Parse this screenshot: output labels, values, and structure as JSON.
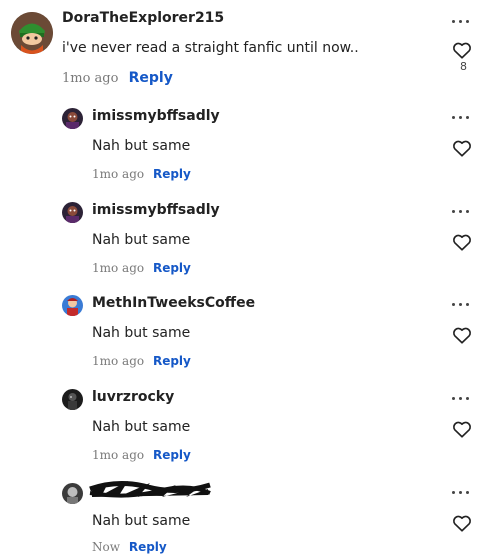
{
  "colors": {
    "reply": "#1558c7",
    "time": "#7a7a7a",
    "text": "#222222"
  },
  "comment": {
    "username": "DoraTheExplorer215",
    "text": "i've never read a straight fanfic until now..",
    "time": "1mo ago",
    "reply_label": "Reply",
    "like_count": "8",
    "avatar_icon": "kyle-avatar-icon"
  },
  "replies": [
    {
      "username": "imissmybffsadly",
      "text": "Nah but same",
      "time": "1mo ago",
      "reply_label": "Reply",
      "avatar_icon": "dark-character-avatar-icon"
    },
    {
      "username": "imissmybffsadly",
      "text": "Nah but same",
      "time": "1mo ago",
      "reply_label": "Reply",
      "avatar_icon": "dark-character-avatar-icon"
    },
    {
      "username": "MethInTweeksCoffee",
      "text": "Nah but same",
      "time": "1mo ago",
      "reply_label": "Reply",
      "avatar_icon": "blue-red-character-avatar-icon"
    },
    {
      "username": "luvrzrocky",
      "text": "Nah but same",
      "time": "1mo ago",
      "reply_label": "Reply",
      "avatar_icon": "dark-figure-avatar-icon"
    },
    {
      "username": "",
      "text": "Nah but same",
      "time": "Now",
      "reply_label": "Reply",
      "avatar_icon": "gray-avatar-icon",
      "username_redacted": true
    }
  ]
}
